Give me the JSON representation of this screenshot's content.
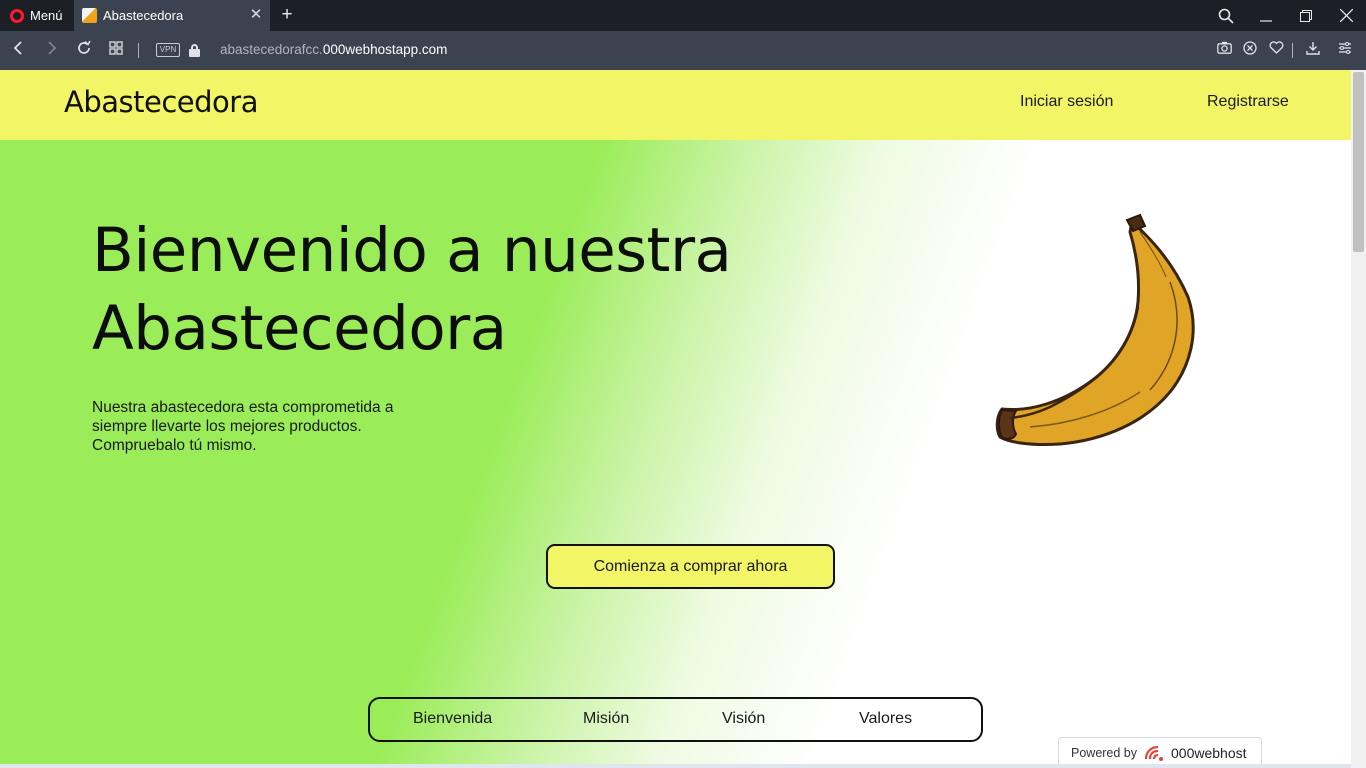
{
  "browser": {
    "menu_label": "Menú",
    "tab_title": "Abastecedora",
    "tab_close": "✕",
    "new_tab": "+",
    "vpn_label": "VPN",
    "url_prefix": "abastecedorafcc.",
    "url_domain": "000webhostapp.com",
    "icons": [
      "back-icon",
      "forward-icon",
      "reload-icon",
      "speed-dial-icon",
      "vpn-icon",
      "lock-icon",
      "camera-icon",
      "adblock-icon",
      "heart-icon",
      "download-icon",
      "easy-setup-icon",
      "search-icon",
      "minimize-icon",
      "restore-icon",
      "close-icon"
    ]
  },
  "site": {
    "brand": "Abastecedora",
    "nav": {
      "login": "Iniciar sesión",
      "register": "Registrarse"
    },
    "hero": {
      "title": "Bienvenido a nuestra Abastecedora",
      "text": "Nuestra abastecedora esta comprometida a siempre llevarte los mejores productos. Compruebalo tú mismo.",
      "cta": "Comienza a comprar ahora"
    },
    "tabs": [
      "Bienvenida",
      "Misión",
      "Visión",
      "Valores"
    ],
    "powered_by": {
      "label": "Powered by",
      "name": "000webhost"
    },
    "colors": {
      "header": "#f1f566",
      "hero_green": "#9aec58",
      "banana": "#e0a526"
    }
  }
}
